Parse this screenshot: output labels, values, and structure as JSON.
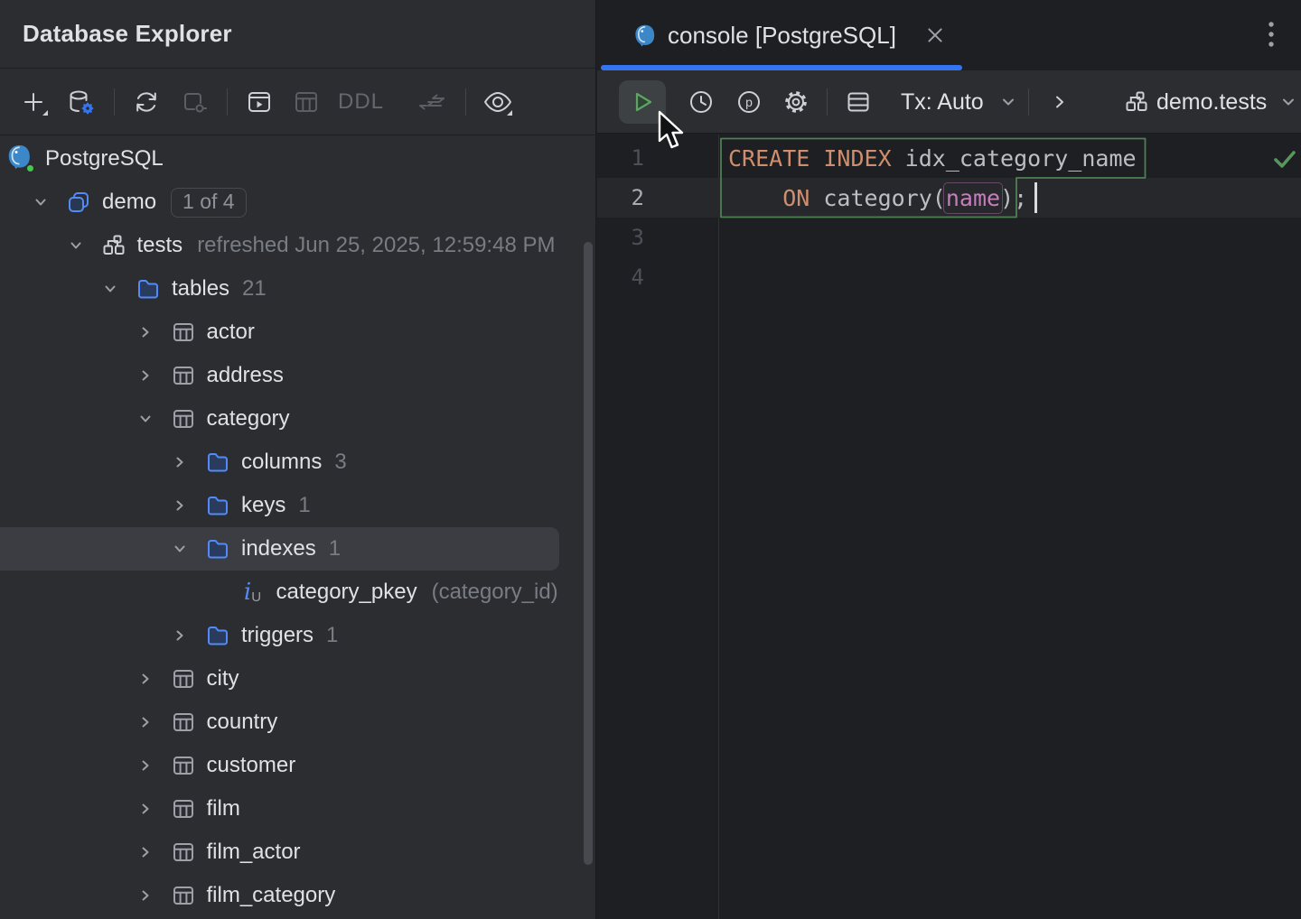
{
  "colors": {
    "panel_bg": "#2B2D30",
    "editor_bg": "#1E1F22",
    "accent_blue": "#3574F0",
    "tree_blue": "#548AF7",
    "selection_gray": "#3B3D42",
    "keyword_orange": "#CF8E6D",
    "identifier_gray": "#BCBEC4",
    "column_purple": "#C77DBB",
    "success_green": "#57965C",
    "statement_border_green": "#4E8052",
    "text_primary": "#DFE1E5",
    "text_muted": "#787C83"
  },
  "left_panel": {
    "title": "Database Explorer",
    "toolbar": {
      "ddl_label": "DDL",
      "icons": [
        {
          "name": "add-icon",
          "enabled": true,
          "dropdown": true
        },
        {
          "name": "data-source-settings-icon",
          "enabled": true
        },
        {
          "name": "refresh-icon",
          "enabled": true
        },
        {
          "name": "detach-icon",
          "enabled": false
        },
        {
          "name": "jump-to-console-icon",
          "enabled": true
        },
        {
          "name": "table-view-icon",
          "enabled": false
        },
        {
          "name": "ddl-label",
          "enabled": false
        },
        {
          "name": "compare-icon",
          "enabled": false
        },
        {
          "name": "preview-icon",
          "enabled": true,
          "dropdown": true
        }
      ]
    },
    "tree": {
      "rows": [
        {
          "level": 0,
          "icon": "postgres",
          "label": "PostgreSQL"
        },
        {
          "level": 1,
          "chevron": "down",
          "icon": "database",
          "label": "demo",
          "badge": "1 of 4"
        },
        {
          "level": 2,
          "chevron": "down",
          "icon": "schema",
          "label": "tests",
          "annotation": "refreshed Jun 25, 2025, 12:59:48 PM"
        },
        {
          "level": 3,
          "chevron": "down",
          "icon": "folder",
          "label": "tables",
          "count": "21"
        },
        {
          "level": 4,
          "chevron": "right",
          "icon": "table",
          "label": "actor"
        },
        {
          "level": 4,
          "chevron": "right",
          "icon": "table",
          "label": "address"
        },
        {
          "level": 4,
          "chevron": "down",
          "icon": "table",
          "label": "category"
        },
        {
          "level": 5,
          "chevron": "right",
          "icon": "folder",
          "label": "columns",
          "count": "3"
        },
        {
          "level": 5,
          "chevron": "right",
          "icon": "folder",
          "label": "keys",
          "count": "1"
        },
        {
          "level": 5,
          "chevron": "down",
          "icon": "folder",
          "label": "indexes",
          "count": "1",
          "selected": true
        },
        {
          "level": 6,
          "icon": "index",
          "label": "category_pkey",
          "annotation": "(category_id)"
        },
        {
          "level": 5,
          "chevron": "right",
          "icon": "folder",
          "label": "triggers",
          "count": "1"
        },
        {
          "level": 4,
          "chevron": "right",
          "icon": "table",
          "label": "city"
        },
        {
          "level": 4,
          "chevron": "right",
          "icon": "table",
          "label": "country"
        },
        {
          "level": 4,
          "chevron": "right",
          "icon": "table",
          "label": "customer"
        },
        {
          "level": 4,
          "chevron": "right",
          "icon": "table",
          "label": "film"
        },
        {
          "level": 4,
          "chevron": "right",
          "icon": "table",
          "label": "film_actor"
        },
        {
          "level": 4,
          "chevron": "right",
          "icon": "table",
          "label": "film_category"
        }
      ]
    }
  },
  "editor": {
    "tab": {
      "title": "console [PostgreSQL]"
    },
    "toolbar": {
      "tx_label": "Tx: Auto",
      "context_label": "demo.tests"
    },
    "code": {
      "status": "success",
      "lines": [
        {
          "no": "1",
          "current": false,
          "segs": [
            [
              "CREATE INDEX ",
              "kw"
            ],
            [
              "idx_category_name",
              "id"
            ]
          ]
        },
        {
          "no": "2",
          "current": true,
          "segs": [
            [
              "    ",
              "id"
            ],
            [
              "ON ",
              "kw"
            ],
            [
              "category(",
              "id"
            ],
            [
              "name",
              "field"
            ],
            [
              ")",
              "id"
            ],
            [
              ";",
              "id"
            ]
          ]
        },
        {
          "no": "3",
          "current": false,
          "segs": []
        },
        {
          "no": "4",
          "current": false,
          "segs": []
        }
      ]
    }
  }
}
